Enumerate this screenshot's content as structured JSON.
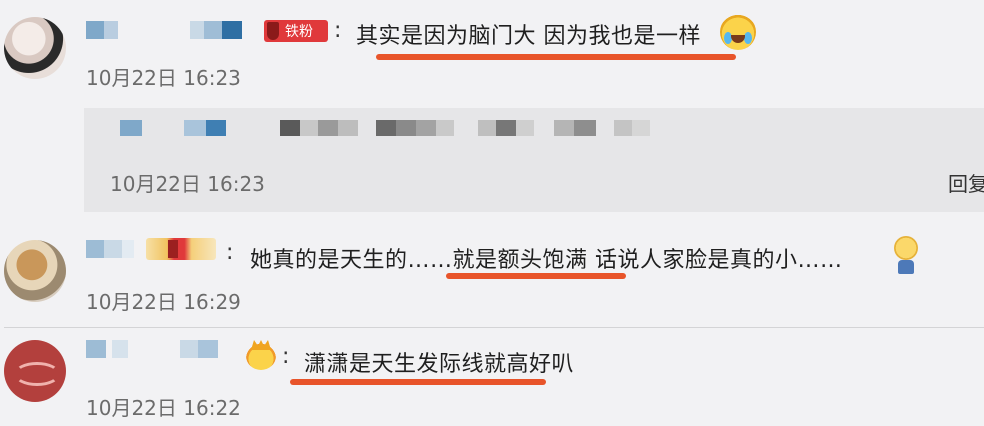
{
  "comments": [
    {
      "badge_label": "铁粉",
      "text": "其实是因为脑门大  因为我也是一样",
      "time": "10月22日 16:23",
      "emoji": "laughing-tears-icon",
      "reply": {
        "time": "10月22日 16:23",
        "action_label": "回复"
      }
    },
    {
      "text": "她真的是天生的……就是额头饱满  话说人家脸是真的小……",
      "time": "10月22日 16:29",
      "emoji": "shy-emoji-icon"
    },
    {
      "text": "潇潇是天生发际线就高好叭",
      "time": "10月22日 16:22",
      "emoji": "crown-emoji-icon"
    }
  ],
  "colors": {
    "underline": "#e8542a",
    "badge_red": "#e0393b",
    "reply_bg": "#e6e6e8",
    "page_bg": "#f2f2f4"
  }
}
